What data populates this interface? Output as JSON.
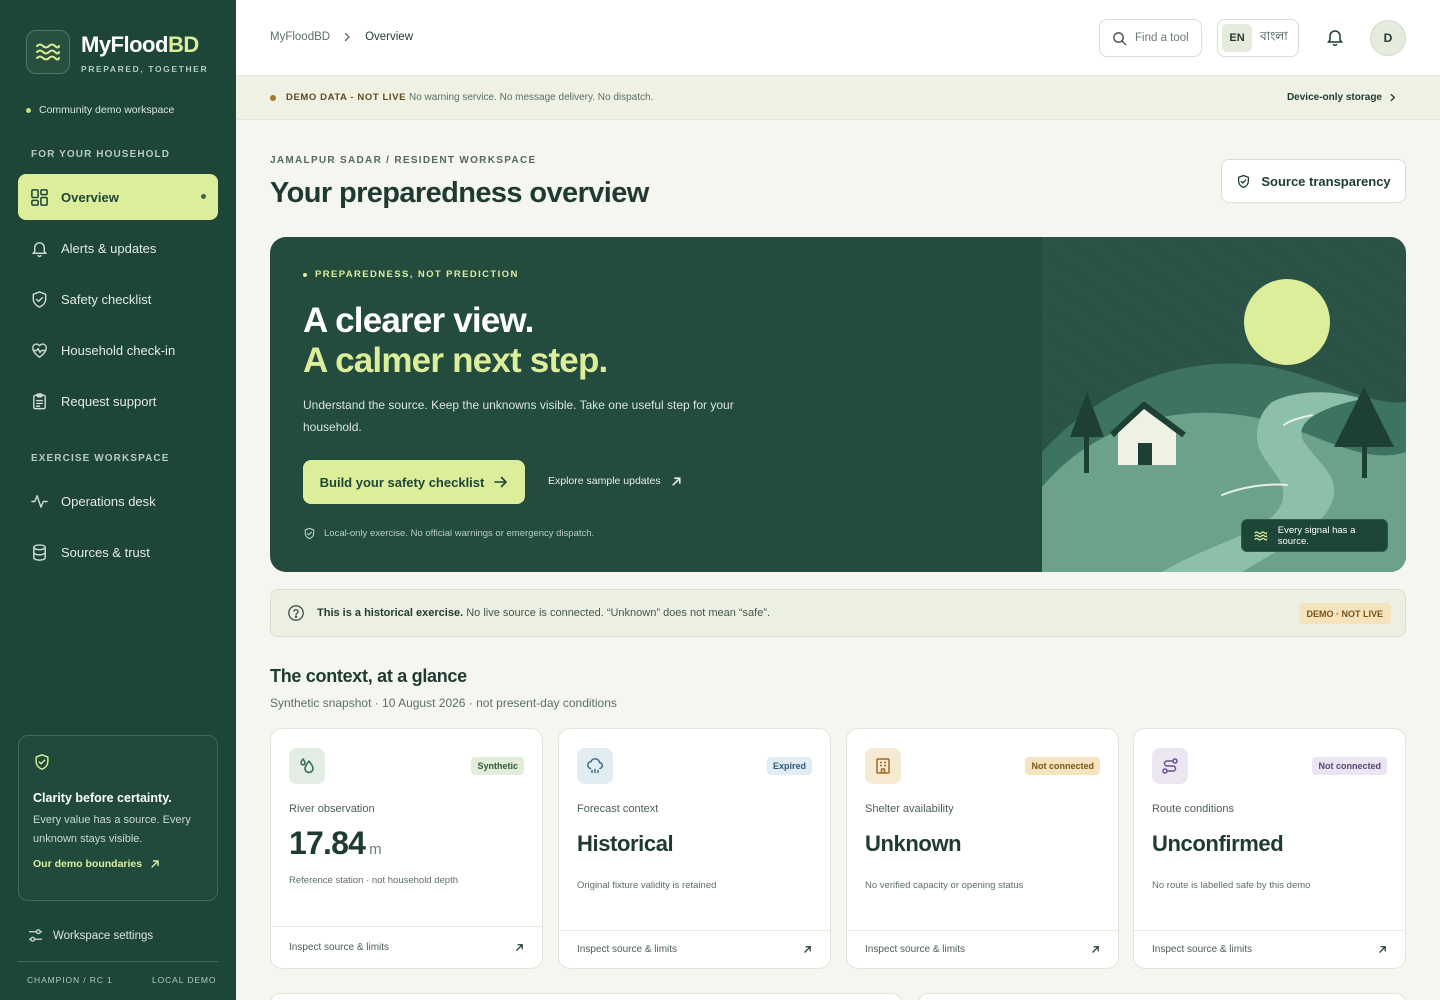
{
  "sidebar": {
    "brand_main": "MyFlood",
    "brand_accent": "BD",
    "brand_tagline": "PREPARED, TOGETHER",
    "workspace": "Community demo workspace",
    "section_household": "FOR YOUR HOUSEHOLD",
    "section_exercise": "EXERCISE WORKSPACE",
    "items": [
      {
        "label": "Overview",
        "icon": "dashboard-icon",
        "active": true
      },
      {
        "label": "Alerts & updates",
        "icon": "bell-icon"
      },
      {
        "label": "Safety checklist",
        "icon": "shield-check-icon"
      },
      {
        "label": "Household check-in",
        "icon": "heart-pulse-icon"
      },
      {
        "label": "Request support",
        "icon": "clipboard-icon"
      },
      {
        "label": "Operations desk",
        "icon": "activity-icon"
      },
      {
        "label": "Sources & trust",
        "icon": "database-icon"
      }
    ],
    "card": {
      "title": "Clarity before certainty.",
      "desc": "Every value has a source. Every unknown stays visible.",
      "link": "Our demo boundaries"
    },
    "settings": "Workspace settings",
    "footer_left": "CHAMPION / RC 1",
    "footer_right": "LOCAL DEMO"
  },
  "topbar": {
    "crumb_root": "MyFloodBD",
    "crumb_current": "Overview",
    "find_placeholder": "Find a tool",
    "lang_en": "EN",
    "lang_bn": "বাংলা",
    "avatar": "D"
  },
  "demo_strip": {
    "label": "DEMO DATA - NOT LIVE",
    "text": "No warning service. No message delivery. No dispatch.",
    "right": "Device-only storage"
  },
  "header": {
    "eyebrow": "JAMALPUR SADAR / RESIDENT WORKSPACE",
    "title": "Your preparedness overview",
    "source_button": "Source transparency"
  },
  "hero": {
    "eyebrow": "PREPAREDNESS, NOT PREDICTION",
    "line1": "A clearer view.",
    "line2": "A calmer next step.",
    "desc": "Understand the source. Keep the unknowns visible. Take one useful step for your household.",
    "cta": "Build your safety checklist",
    "secondary": "Explore sample updates",
    "note": "Local-only exercise. No official warnings or emergency dispatch.",
    "signal": "Every signal has a source."
  },
  "info": {
    "bold": "This is a historical exercise.",
    "text": "No live source is connected. “Unknown” does not mean “safe”.",
    "badge": "DEMO · NOT LIVE"
  },
  "context": {
    "title": "The context, at a glance",
    "subtitle": "Synthetic snapshot · 10 August 2026 · not present-day conditions",
    "cards": [
      {
        "label": "River observation",
        "value": "17.84",
        "unit": "m",
        "fine": "Reference station · not household depth",
        "badge": "Synthetic",
        "footer": "Inspect source & limits",
        "icon": "water-drops-icon"
      },
      {
        "label": "Forecast context",
        "value": "Historical",
        "fine": "Original fixture validity is retained",
        "badge": "Expired",
        "footer": "Inspect source & limits",
        "icon": "cloud-rain-icon"
      },
      {
        "label": "Shelter availability",
        "value": "Unknown",
        "fine": "No verified capacity or opening status",
        "badge": "Not connected",
        "footer": "Inspect source & limits",
        "icon": "building-icon"
      },
      {
        "label": "Route conditions",
        "value": "Unconfirmed",
        "fine": "No route is labelled safe by this demo",
        "badge": "Not connected",
        "footer": "Inspect source & limits",
        "icon": "route-icon"
      }
    ]
  },
  "colors": {
    "sidebar": "#1d4538",
    "accent": "#dcee9a",
    "hero": "#234b3e"
  }
}
